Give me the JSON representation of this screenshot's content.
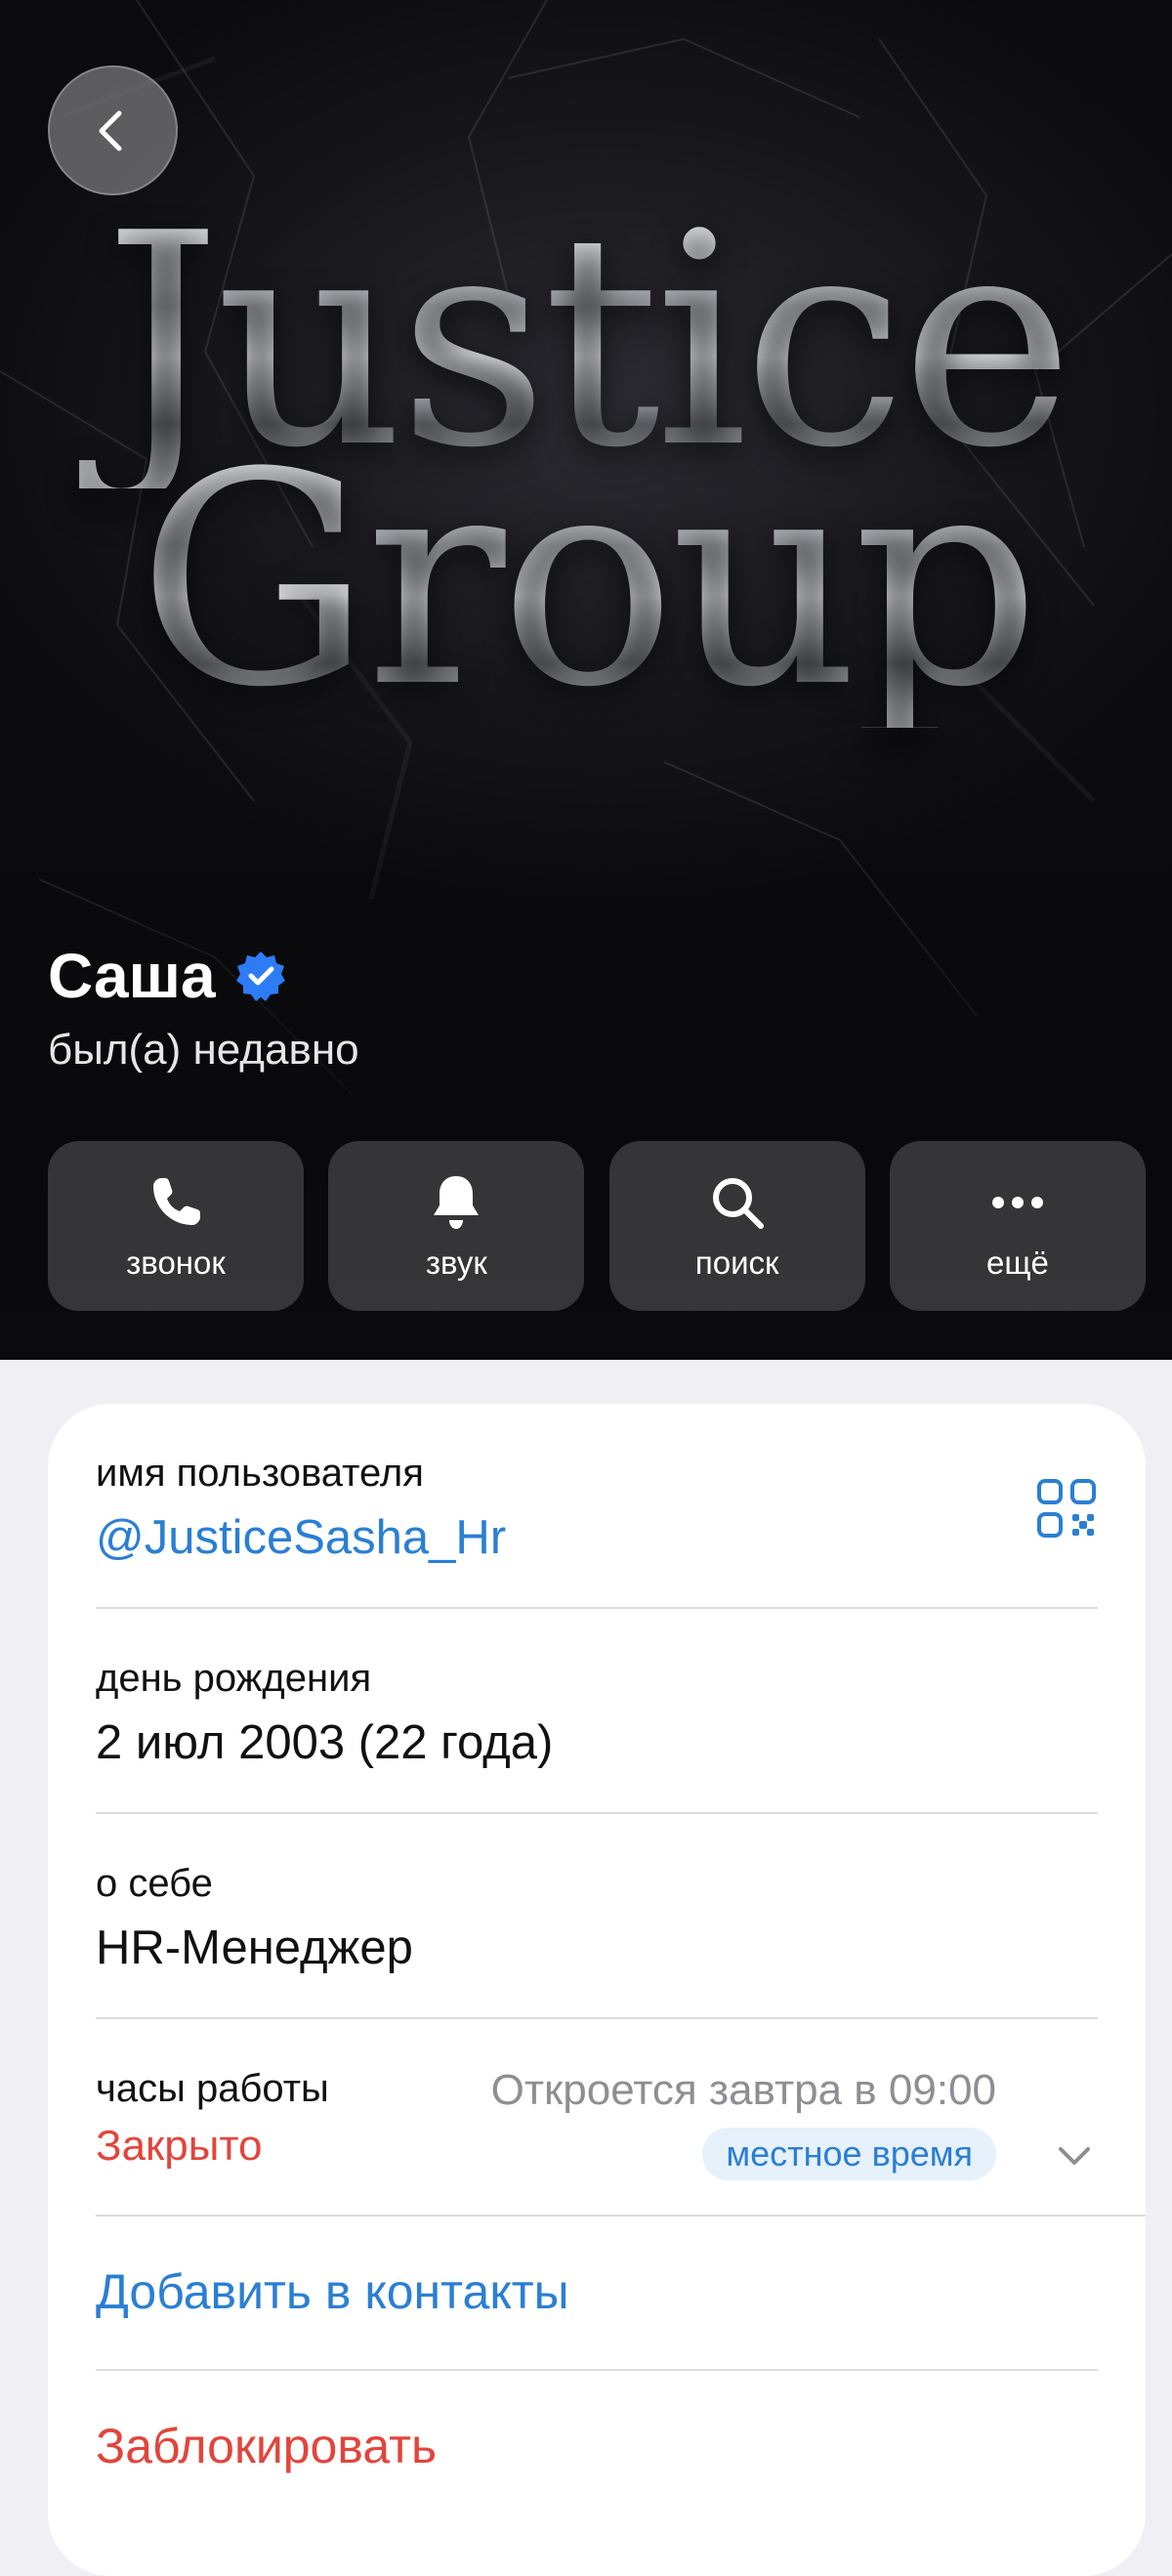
{
  "header": {
    "logo_line1": "Justice",
    "logo_line2": "Group",
    "back_icon": "chevron-left-icon"
  },
  "profile": {
    "name": "Саша",
    "verified": true,
    "status": "был(а) недавно"
  },
  "actions": [
    {
      "icon": "phone-icon",
      "label": "звонок"
    },
    {
      "icon": "bell-icon",
      "label": "звук"
    },
    {
      "icon": "search-icon",
      "label": "поиск"
    },
    {
      "icon": "more-icon",
      "label": "ещё"
    }
  ],
  "info": {
    "username_label": "имя пользователя",
    "username_value": "@JusticeSasha_Hr",
    "birthday_label": "день рождения",
    "birthday_value": "2 июл 2003 (22 года)",
    "about_label": "о себе",
    "about_value": "HR-Менеджер",
    "hours_label": "часы работы",
    "hours_status": "Закрыто",
    "hours_next": "Откроется завтра в 09:00",
    "hours_badge": "местное время"
  },
  "buttons": {
    "add_contact": "Добавить в контакты",
    "block": "Заблокировать"
  },
  "colors": {
    "accent": "#2a7fd4",
    "danger": "#e2453c",
    "verified": "#2d7cf6",
    "background": "#efeff4"
  }
}
